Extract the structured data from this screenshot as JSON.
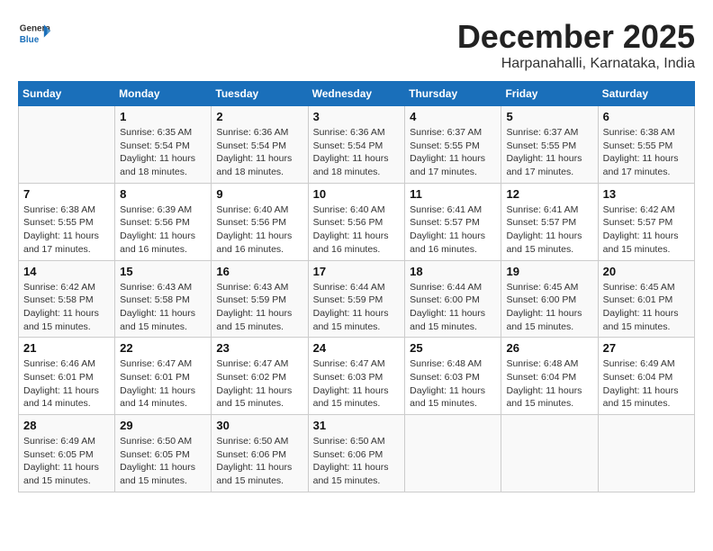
{
  "header": {
    "logo_general": "General",
    "logo_blue": "Blue",
    "month_title": "December 2025",
    "location": "Harpanahalli, Karnataka, India"
  },
  "days_of_week": [
    "Sunday",
    "Monday",
    "Tuesday",
    "Wednesday",
    "Thursday",
    "Friday",
    "Saturday"
  ],
  "weeks": [
    [
      {
        "day": "",
        "info": ""
      },
      {
        "day": "1",
        "info": "Sunrise: 6:35 AM\nSunset: 5:54 PM\nDaylight: 11 hours and 18 minutes."
      },
      {
        "day": "2",
        "info": "Sunrise: 6:36 AM\nSunset: 5:54 PM\nDaylight: 11 hours and 18 minutes."
      },
      {
        "day": "3",
        "info": "Sunrise: 6:36 AM\nSunset: 5:54 PM\nDaylight: 11 hours and 18 minutes."
      },
      {
        "day": "4",
        "info": "Sunrise: 6:37 AM\nSunset: 5:55 PM\nDaylight: 11 hours and 17 minutes."
      },
      {
        "day": "5",
        "info": "Sunrise: 6:37 AM\nSunset: 5:55 PM\nDaylight: 11 hours and 17 minutes."
      },
      {
        "day": "6",
        "info": "Sunrise: 6:38 AM\nSunset: 5:55 PM\nDaylight: 11 hours and 17 minutes."
      }
    ],
    [
      {
        "day": "7",
        "info": "Sunrise: 6:38 AM\nSunset: 5:55 PM\nDaylight: 11 hours and 17 minutes."
      },
      {
        "day": "8",
        "info": "Sunrise: 6:39 AM\nSunset: 5:56 PM\nDaylight: 11 hours and 16 minutes."
      },
      {
        "day": "9",
        "info": "Sunrise: 6:40 AM\nSunset: 5:56 PM\nDaylight: 11 hours and 16 minutes."
      },
      {
        "day": "10",
        "info": "Sunrise: 6:40 AM\nSunset: 5:56 PM\nDaylight: 11 hours and 16 minutes."
      },
      {
        "day": "11",
        "info": "Sunrise: 6:41 AM\nSunset: 5:57 PM\nDaylight: 11 hours and 16 minutes."
      },
      {
        "day": "12",
        "info": "Sunrise: 6:41 AM\nSunset: 5:57 PM\nDaylight: 11 hours and 15 minutes."
      },
      {
        "day": "13",
        "info": "Sunrise: 6:42 AM\nSunset: 5:57 PM\nDaylight: 11 hours and 15 minutes."
      }
    ],
    [
      {
        "day": "14",
        "info": "Sunrise: 6:42 AM\nSunset: 5:58 PM\nDaylight: 11 hours and 15 minutes."
      },
      {
        "day": "15",
        "info": "Sunrise: 6:43 AM\nSunset: 5:58 PM\nDaylight: 11 hours and 15 minutes."
      },
      {
        "day": "16",
        "info": "Sunrise: 6:43 AM\nSunset: 5:59 PM\nDaylight: 11 hours and 15 minutes."
      },
      {
        "day": "17",
        "info": "Sunrise: 6:44 AM\nSunset: 5:59 PM\nDaylight: 11 hours and 15 minutes."
      },
      {
        "day": "18",
        "info": "Sunrise: 6:44 AM\nSunset: 6:00 PM\nDaylight: 11 hours and 15 minutes."
      },
      {
        "day": "19",
        "info": "Sunrise: 6:45 AM\nSunset: 6:00 PM\nDaylight: 11 hours and 15 minutes."
      },
      {
        "day": "20",
        "info": "Sunrise: 6:45 AM\nSunset: 6:01 PM\nDaylight: 11 hours and 15 minutes."
      }
    ],
    [
      {
        "day": "21",
        "info": "Sunrise: 6:46 AM\nSunset: 6:01 PM\nDaylight: 11 hours and 14 minutes."
      },
      {
        "day": "22",
        "info": "Sunrise: 6:47 AM\nSunset: 6:01 PM\nDaylight: 11 hours and 14 minutes."
      },
      {
        "day": "23",
        "info": "Sunrise: 6:47 AM\nSunset: 6:02 PM\nDaylight: 11 hours and 15 minutes."
      },
      {
        "day": "24",
        "info": "Sunrise: 6:47 AM\nSunset: 6:03 PM\nDaylight: 11 hours and 15 minutes."
      },
      {
        "day": "25",
        "info": "Sunrise: 6:48 AM\nSunset: 6:03 PM\nDaylight: 11 hours and 15 minutes."
      },
      {
        "day": "26",
        "info": "Sunrise: 6:48 AM\nSunset: 6:04 PM\nDaylight: 11 hours and 15 minutes."
      },
      {
        "day": "27",
        "info": "Sunrise: 6:49 AM\nSunset: 6:04 PM\nDaylight: 11 hours and 15 minutes."
      }
    ],
    [
      {
        "day": "28",
        "info": "Sunrise: 6:49 AM\nSunset: 6:05 PM\nDaylight: 11 hours and 15 minutes."
      },
      {
        "day": "29",
        "info": "Sunrise: 6:50 AM\nSunset: 6:05 PM\nDaylight: 11 hours and 15 minutes."
      },
      {
        "day": "30",
        "info": "Sunrise: 6:50 AM\nSunset: 6:06 PM\nDaylight: 11 hours and 15 minutes."
      },
      {
        "day": "31",
        "info": "Sunrise: 6:50 AM\nSunset: 6:06 PM\nDaylight: 11 hours and 15 minutes."
      },
      {
        "day": "",
        "info": ""
      },
      {
        "day": "",
        "info": ""
      },
      {
        "day": "",
        "info": ""
      }
    ]
  ]
}
